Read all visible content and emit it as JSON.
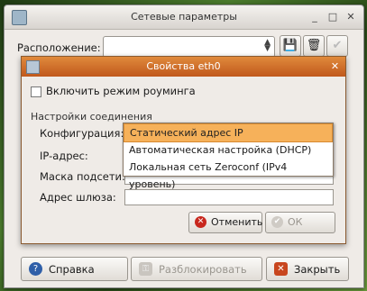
{
  "outer_window": {
    "title": "Сетевые параметры",
    "location_label": "Расположение:",
    "location_value": "",
    "buttons": {
      "help": "Справка",
      "unlock": "Разблокировать",
      "close": "Закрыть"
    }
  },
  "dialog": {
    "title": "Свойства eth0",
    "roaming_label": "Включить режим роуминга",
    "section_title": "Настройки соединения",
    "labels": {
      "config": "Конфигурация:",
      "ip": "IP-адрес:",
      "mask": "Маска подсети:",
      "gateway": "Адрес шлюза:"
    },
    "config_options": [
      "Статический адрес IP",
      "Автоматическая настройка (DHCP)",
      "Локальная сеть Zeroconf (IPv4 уровень)"
    ],
    "selected_index": 0,
    "buttons": {
      "cancel": "Отменить",
      "ok": "ОК"
    }
  },
  "colors": {
    "dialog_titlebar": "#d06a28",
    "selected_option": "#f6b15a"
  }
}
